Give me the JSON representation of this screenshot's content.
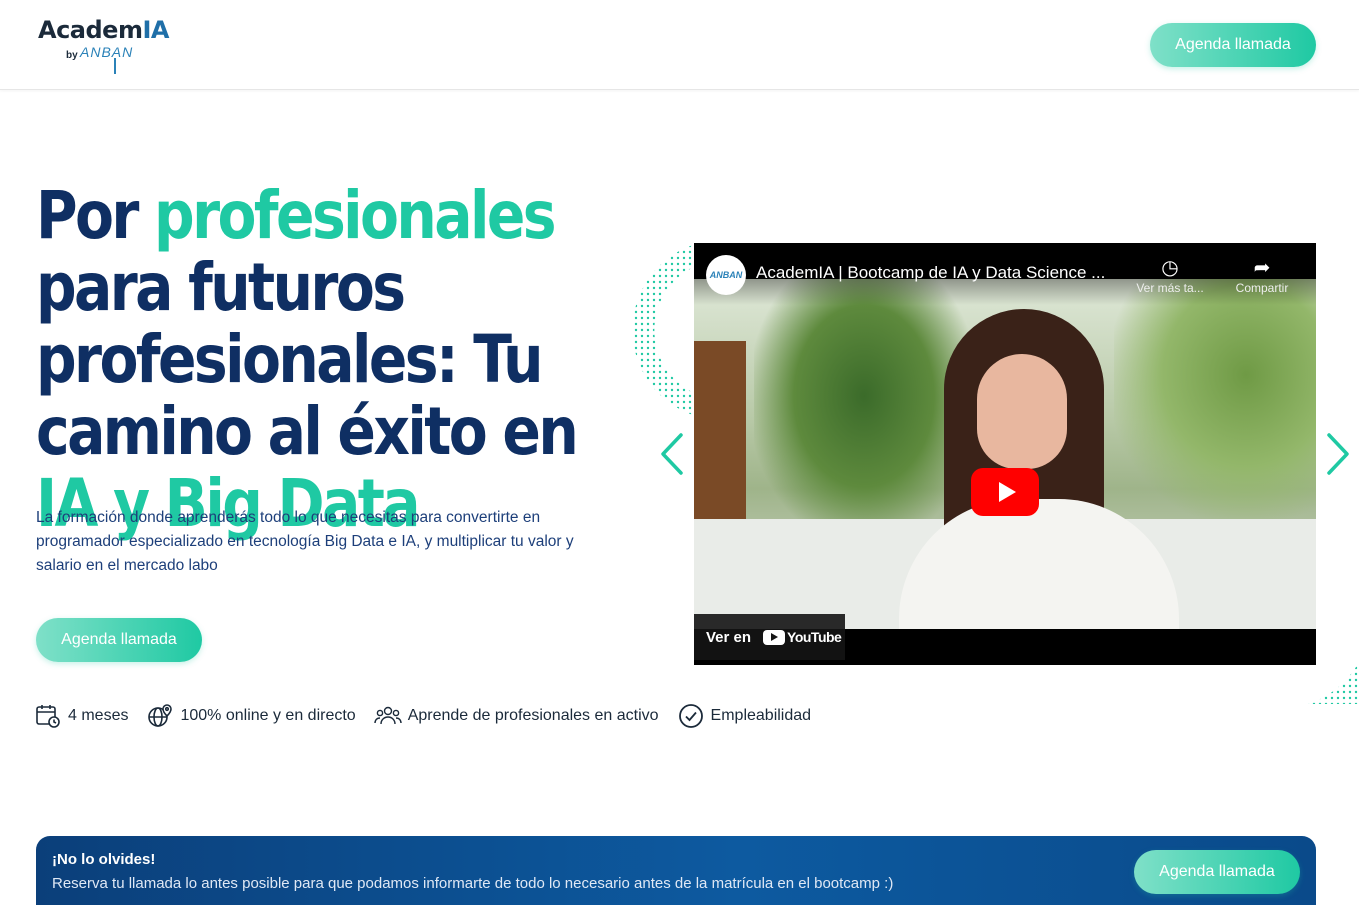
{
  "header": {
    "logo": {
      "main": "Academ",
      "accent": "IA",
      "by": "by",
      "brand": "ANBAN"
    },
    "cta_label": "Agenda llamada"
  },
  "hero": {
    "title_part1": "Por ",
    "title_accent1": "profesionales",
    "title_part2": " para futuros profesionales: Tu camino al éxito en ",
    "title_accent2": "IA y Big Data",
    "description": "La formación donde aprenderás todo lo que necesitas para convertirte en programador especializado en tecnología Big Data e IA, y multiplicar tu valor y salario en el mercado labo",
    "cta_label": "Agenda llamada"
  },
  "features": [
    {
      "icon": "calendar-clock-icon",
      "label": "4 meses"
    },
    {
      "icon": "globe-pin-icon",
      "label": "100% online y en directo"
    },
    {
      "icon": "people-group-icon",
      "label": "Aprende de profesionales en activo"
    },
    {
      "icon": "check-circle-icon",
      "label": "Empleabilidad"
    }
  ],
  "video": {
    "channel_badge": "ANBAN",
    "title": "AcademIA | Bootcamp de IA y Data Science ...",
    "watch_later": "Ver más ta...",
    "share": "Compartir",
    "watch_on": "Ver en",
    "youtube": "YouTube"
  },
  "banner": {
    "title": "¡No lo olvides!",
    "text": "Reserva tu llamada lo antes posible para que podamos informarte de todo lo necesario antes de la matrícula en el bootcamp :)",
    "cta_label": "Agenda llamada"
  },
  "colors": {
    "primary_navy": "#0f2f63",
    "accent_teal": "#1fc9a3",
    "banner_blue": "#0d5aa0",
    "youtube_red": "#ff0000"
  }
}
